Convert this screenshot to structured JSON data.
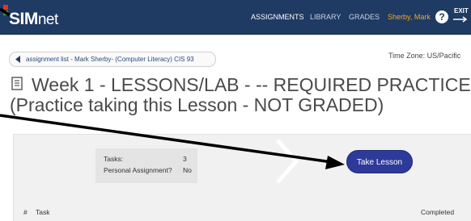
{
  "brand": {
    "colors": {
      "nav": "#1f3a63",
      "accent_user": "#f5a623",
      "button": "#2e3a9a"
    }
  },
  "logo": {
    "text_bold": "SIM",
    "text_light": "net"
  },
  "nav": {
    "items": [
      {
        "label": "ASSIGNMENTS",
        "active": true
      },
      {
        "label": "LIBRARY",
        "active": false
      },
      {
        "label": "GRADES",
        "active": false
      }
    ],
    "user": "Sherby, Mark",
    "help_icon": "?",
    "exit_label": "EXIT"
  },
  "breadcrumb": {
    "label": "assignment list - Mark Sherby- (Computer Literacy) CIS 93"
  },
  "timezone": "Time Zone: US/Pacific",
  "title": {
    "line1": "Week 1 - LESSONS/LAB - -- REQUIRED PRACTICE",
    "line2": "(Practice taking this Lesson - NOT GRADED)"
  },
  "info": {
    "tasks_label": "Tasks:",
    "tasks_value": "3",
    "personal_label": "Personal Assignment?",
    "personal_value": "No"
  },
  "take_lesson": "Take Lesson",
  "table": {
    "col_num": "#",
    "col_task": "Task",
    "col_completed": "Completed"
  }
}
